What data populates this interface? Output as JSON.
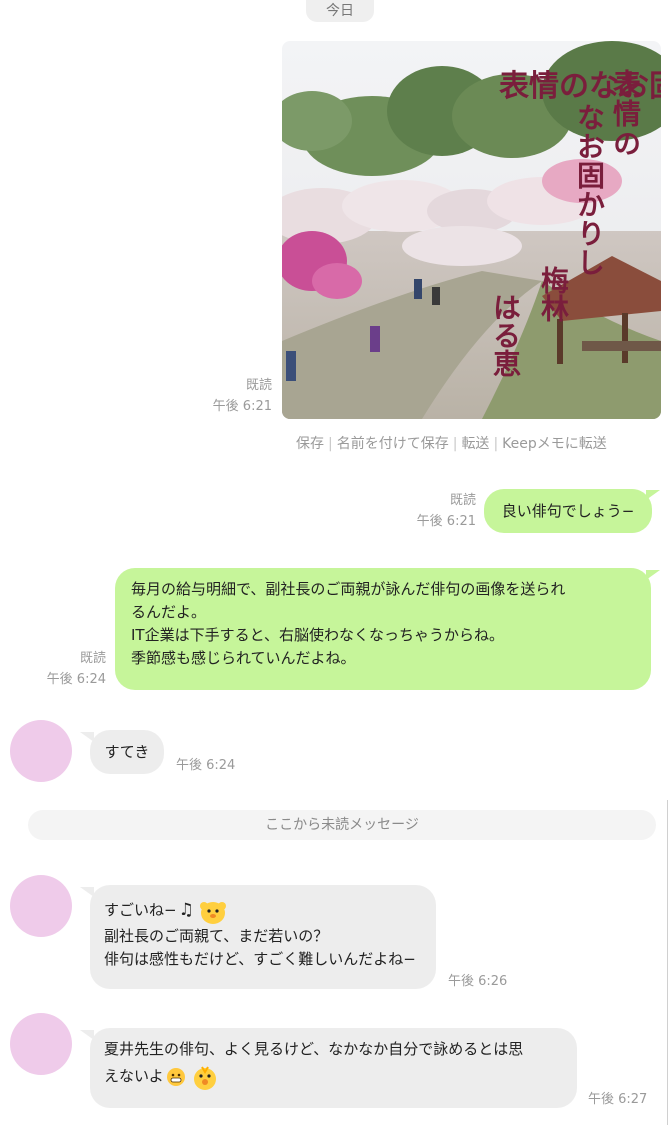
{
  "date_divider": "今日",
  "photo_message": {
    "read_label": "既読",
    "time": "午後 6:21",
    "poem_title": "表情のなお固かりし",
    "poem_subject": "梅林",
    "poem_author": "はる恵"
  },
  "image_actions": [
    "保存",
    "名前を付けて保存",
    "転送",
    "Keepメモに転送"
  ],
  "sent_message_1": {
    "text": "良い俳句でしょう−",
    "read_label": "既読",
    "time": "午後 6:21"
  },
  "sent_message_2": {
    "lines": [
      "毎月の給与明細で、副社長のご両親が詠んだ俳句の画像を送られ",
      "るんだよ。",
      "IT企業は下手すると、右脳使わなくなっちゃうからね。",
      "季節感も感じられていんだよね。"
    ],
    "read_label": "既読",
    "time": "午後 6:24"
  },
  "received_message_1": {
    "text": "すてき",
    "time": "午後 6:24"
  },
  "unread_divider": "ここから未読メッセージ",
  "received_message_2": {
    "lines": [
      "すごいね−",
      "副社長のご両親て、まだ若いの？",
      "俳句は感性もだけど、すごく難しいんだよね−"
    ],
    "time": "午後 6:26"
  },
  "received_message_3": {
    "lines": [
      "夏井先生の俳句、よく見るけど、なかなか自分で詠めるとは思",
      "えないよ"
    ],
    "time": "午後 6:27"
  },
  "colors": {
    "sent_bubble": "#c6f59a",
    "received_bubble": "#ededed",
    "avatar": "#efcbea",
    "poem_text": "#7a1e3c"
  }
}
